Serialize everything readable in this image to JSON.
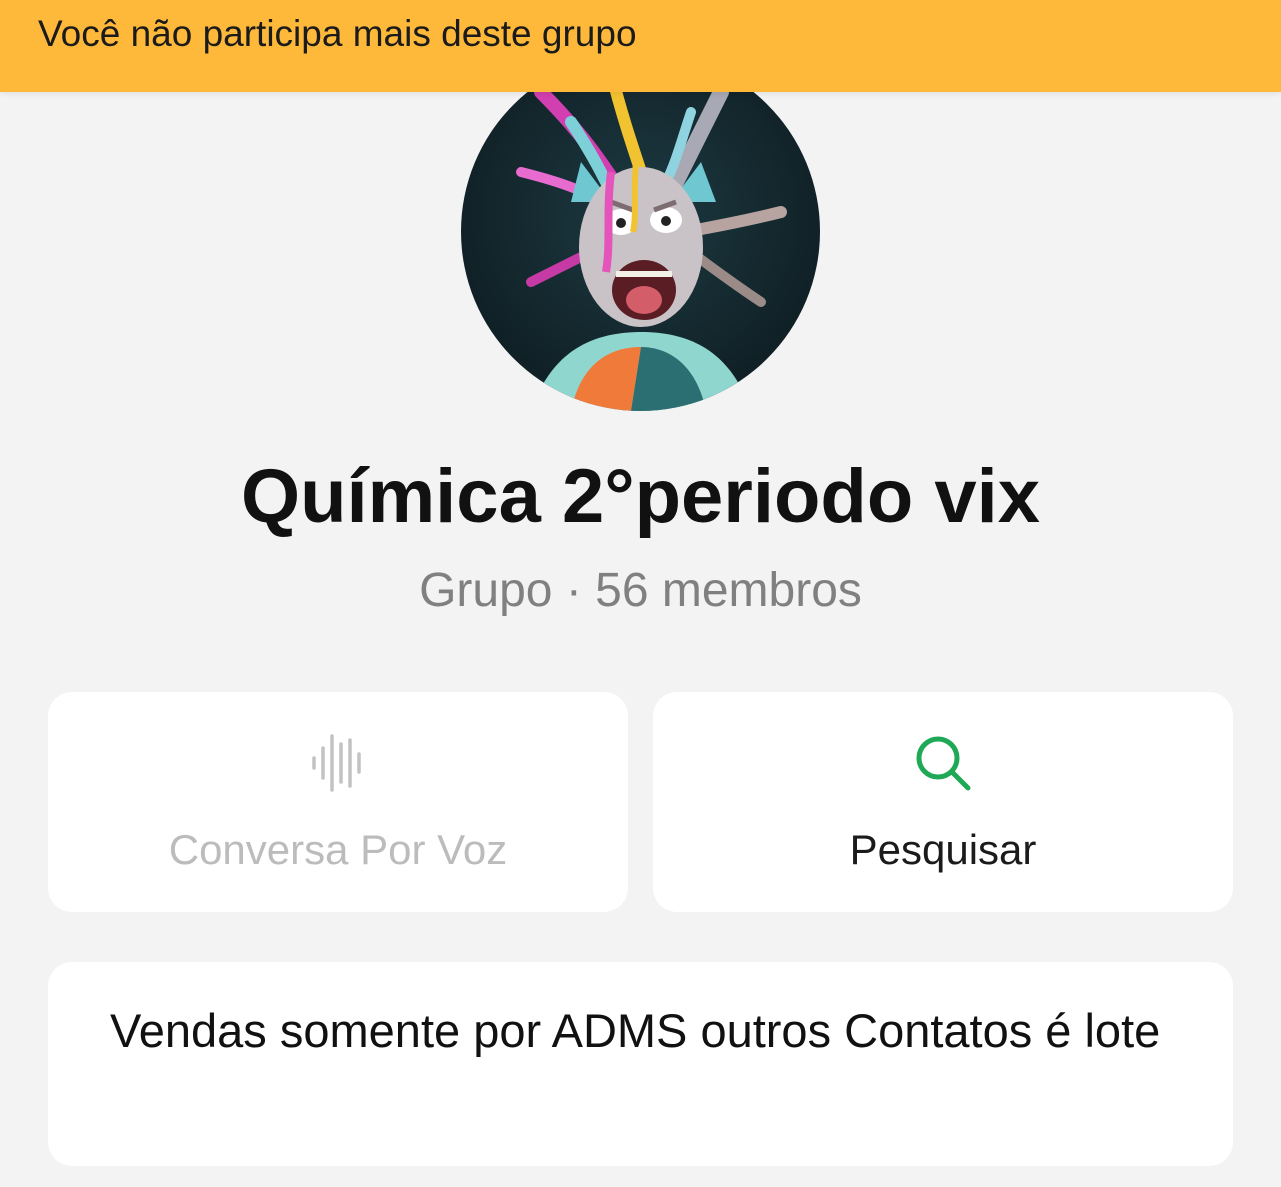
{
  "banner": {
    "text": "Você não participa mais deste grupo"
  },
  "group": {
    "name": "Química 2°periodo vix",
    "subtitle": "Grupo · 56 membros"
  },
  "actions": {
    "voice": {
      "label": "Conversa Por Voz",
      "icon": "waveform-icon",
      "enabled": false
    },
    "search": {
      "label": "Pesquisar",
      "icon": "search-icon",
      "enabled": true
    }
  },
  "description": {
    "text": "Vendas somente por ADMS outros Contatos é lote"
  },
  "colors": {
    "banner": "#ffb93a",
    "accent": "#1fa855",
    "background": "#f3f3f3",
    "disabled": "#bcbcbc"
  }
}
